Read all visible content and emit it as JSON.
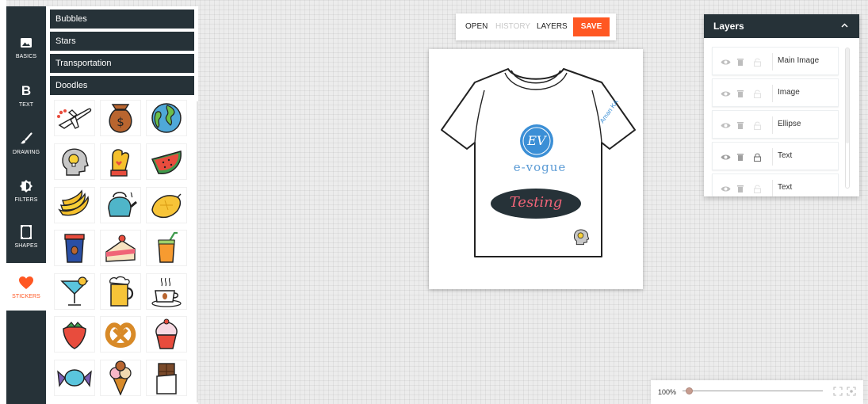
{
  "nav": {
    "items": [
      {
        "label": "BASICS",
        "icon": "image-icon",
        "active": false
      },
      {
        "label": "TEXT",
        "icon": "text-b-icon",
        "glyph": "B",
        "active": false
      },
      {
        "label": "DRAWING",
        "icon": "brush-icon",
        "active": false
      },
      {
        "label": "FILTERS",
        "icon": "filter-icon",
        "active": false
      },
      {
        "label": "SHAPES",
        "icon": "shape-icon",
        "active": false
      },
      {
        "label": "STICKERS",
        "icon": "heart-icon",
        "active": true
      }
    ]
  },
  "sticker_panel": {
    "categories": [
      "Bubbles",
      "Stars",
      "Transportation",
      "Doodles"
    ],
    "stickers": [
      "airplane-sticker",
      "money-bag-sticker",
      "globe-sticker",
      "idea-head-sticker",
      "oven-mitt-sticker",
      "watermelon-sticker",
      "bananas-sticker",
      "kettle-sticker",
      "lemon-sticker",
      "coffee-cup-sticker",
      "cake-sticker",
      "juice-sticker",
      "cocktail-sticker",
      "beer-sticker",
      "coffee-sticker",
      "strawberry-sticker",
      "pretzel-sticker",
      "cupcake-sticker",
      "candy-sticker",
      "ice-cream-sticker",
      "chocolate-sticker"
    ]
  },
  "toolbar": {
    "open": "OPEN",
    "history": "HISTORY",
    "layers": "LAYERS",
    "save": "SAVE"
  },
  "canvas": {
    "logo_text": "EV",
    "brand_text": "e-vogue",
    "ellipse_text": "Testing",
    "sleeve_text": "Aman KA"
  },
  "layers_panel": {
    "title": "Layers",
    "items": [
      {
        "name": "Main Image",
        "locked": false
      },
      {
        "name": "Image",
        "locked": false
      },
      {
        "name": "Ellipse",
        "locked": false
      },
      {
        "name": "Text",
        "locked": true
      },
      {
        "name": "Text",
        "locked": false
      }
    ]
  },
  "zoom": {
    "label": "100%",
    "level": 0.05
  },
  "colors": {
    "dark": "#263238",
    "accent": "#ff5722",
    "brand_blue": "#3b8fd6",
    "ellipse_fill": "#263238",
    "ellipse_text": "#f06478"
  }
}
